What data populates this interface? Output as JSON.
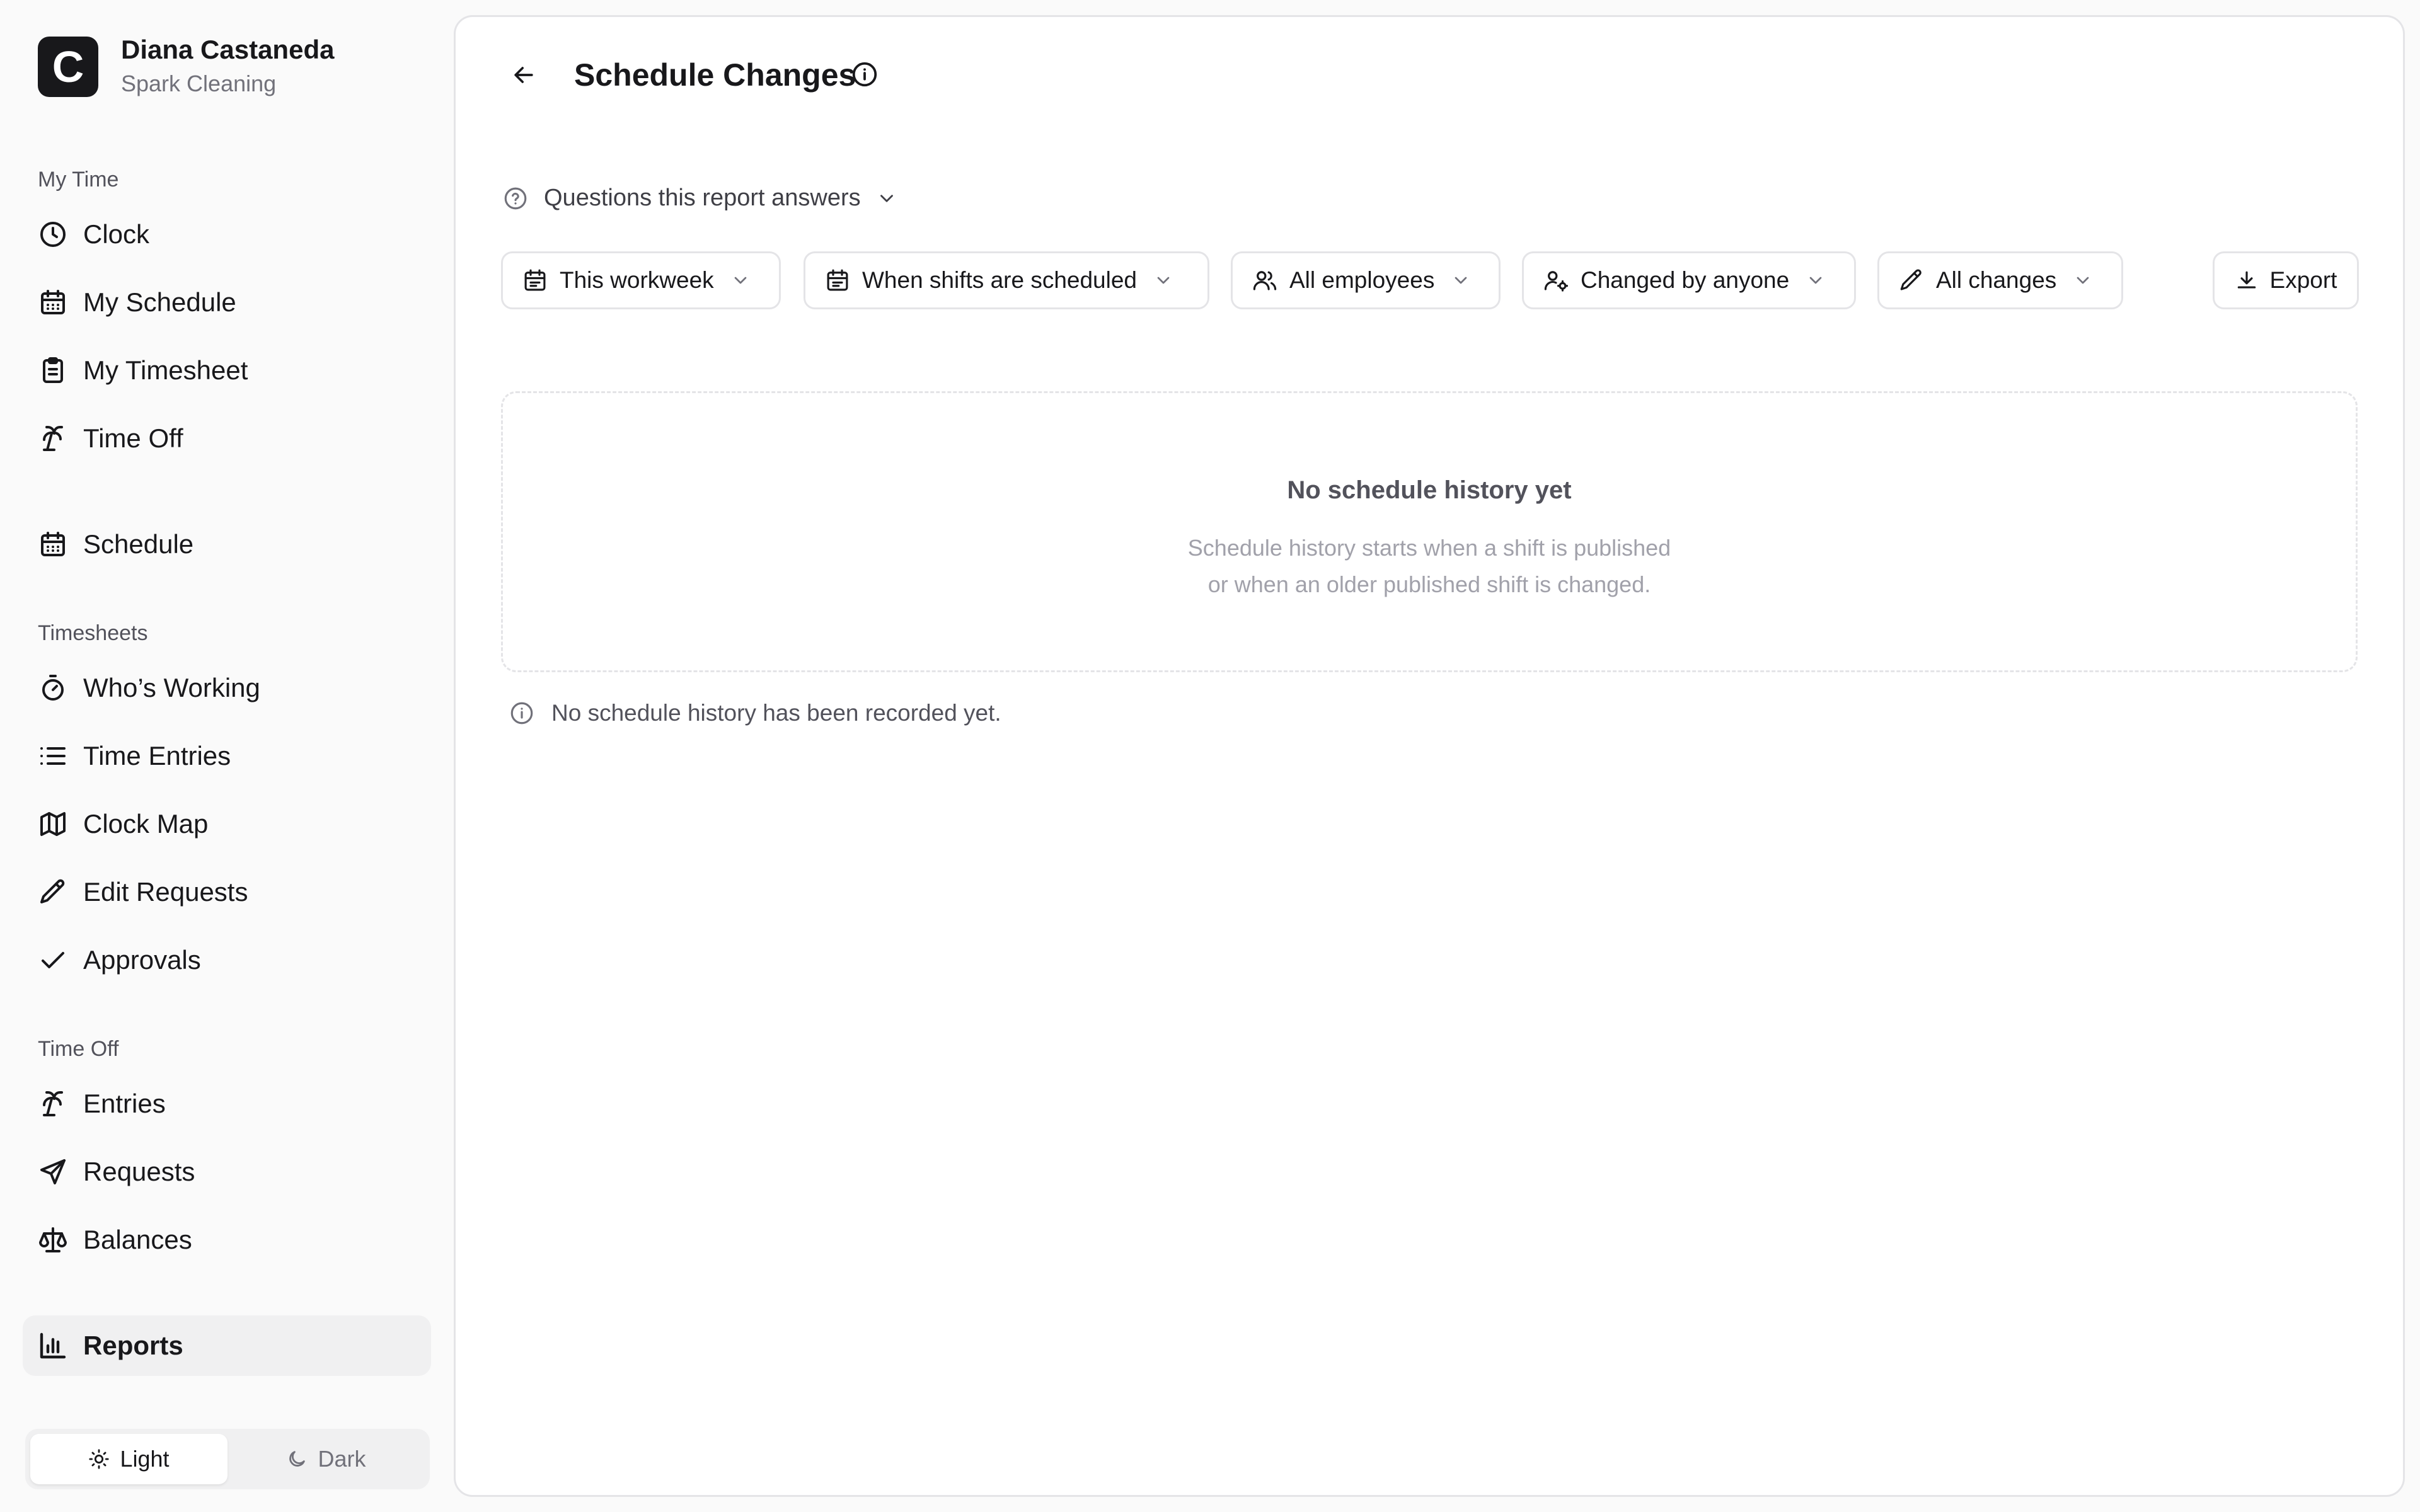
{
  "user": {
    "name": "Diana Castaneda",
    "org": "Spark Cleaning",
    "logo_letter": "C"
  },
  "sidebar": {
    "sections": {
      "my_time": "My Time",
      "timesheets": "Timesheets",
      "time_off": "Time Off"
    },
    "items": {
      "clock": {
        "label": "Clock",
        "icon": "clock-icon"
      },
      "my_schedule": {
        "label": "My Schedule",
        "icon": "calendar-icon"
      },
      "my_timesheet": {
        "label": "My Timesheet",
        "icon": "clipboard-icon"
      },
      "time_off": {
        "label": "Time Off",
        "icon": "palm-tree-icon"
      },
      "schedule": {
        "label": "Schedule",
        "icon": "calendar-icon"
      },
      "whos_working": {
        "label": "Who’s Working",
        "icon": "stopwatch-icon"
      },
      "time_entries": {
        "label": "Time Entries",
        "icon": "list-icon"
      },
      "clock_map": {
        "label": "Clock Map",
        "icon": "map-icon"
      },
      "edit_requests": {
        "label": "Edit Requests",
        "icon": "pencil-icon"
      },
      "approvals": {
        "label": "Approvals",
        "icon": "check-icon"
      },
      "entries": {
        "label": "Entries",
        "icon": "palm-tree-icon"
      },
      "requests": {
        "label": "Requests",
        "icon": "send-icon"
      },
      "balances": {
        "label": "Balances",
        "icon": "scale-icon"
      },
      "reports": {
        "label": "Reports",
        "icon": "bar-chart-icon",
        "active": true
      }
    },
    "theme": {
      "light": "Light",
      "dark": "Dark",
      "selected": "Light"
    }
  },
  "page": {
    "title": "Schedule Changes",
    "questions_label": "Questions this report answers",
    "filters": {
      "period": "This workweek",
      "date_basis": "When shifts are scheduled",
      "employees": "All employees",
      "changed_by": "Changed by anyone",
      "change_type": "All changes"
    },
    "export_label": "Export",
    "empty": {
      "title": "No schedule history yet",
      "line1": "Schedule history starts when a shift is published",
      "line2": "or when an older published shift is changed."
    },
    "note": "No schedule history has been recorded yet."
  },
  "colors": {
    "accent": "#18181b",
    "muted": "#71717a",
    "border": "#e4e4e7",
    "active_bg": "#f0f0f1"
  }
}
